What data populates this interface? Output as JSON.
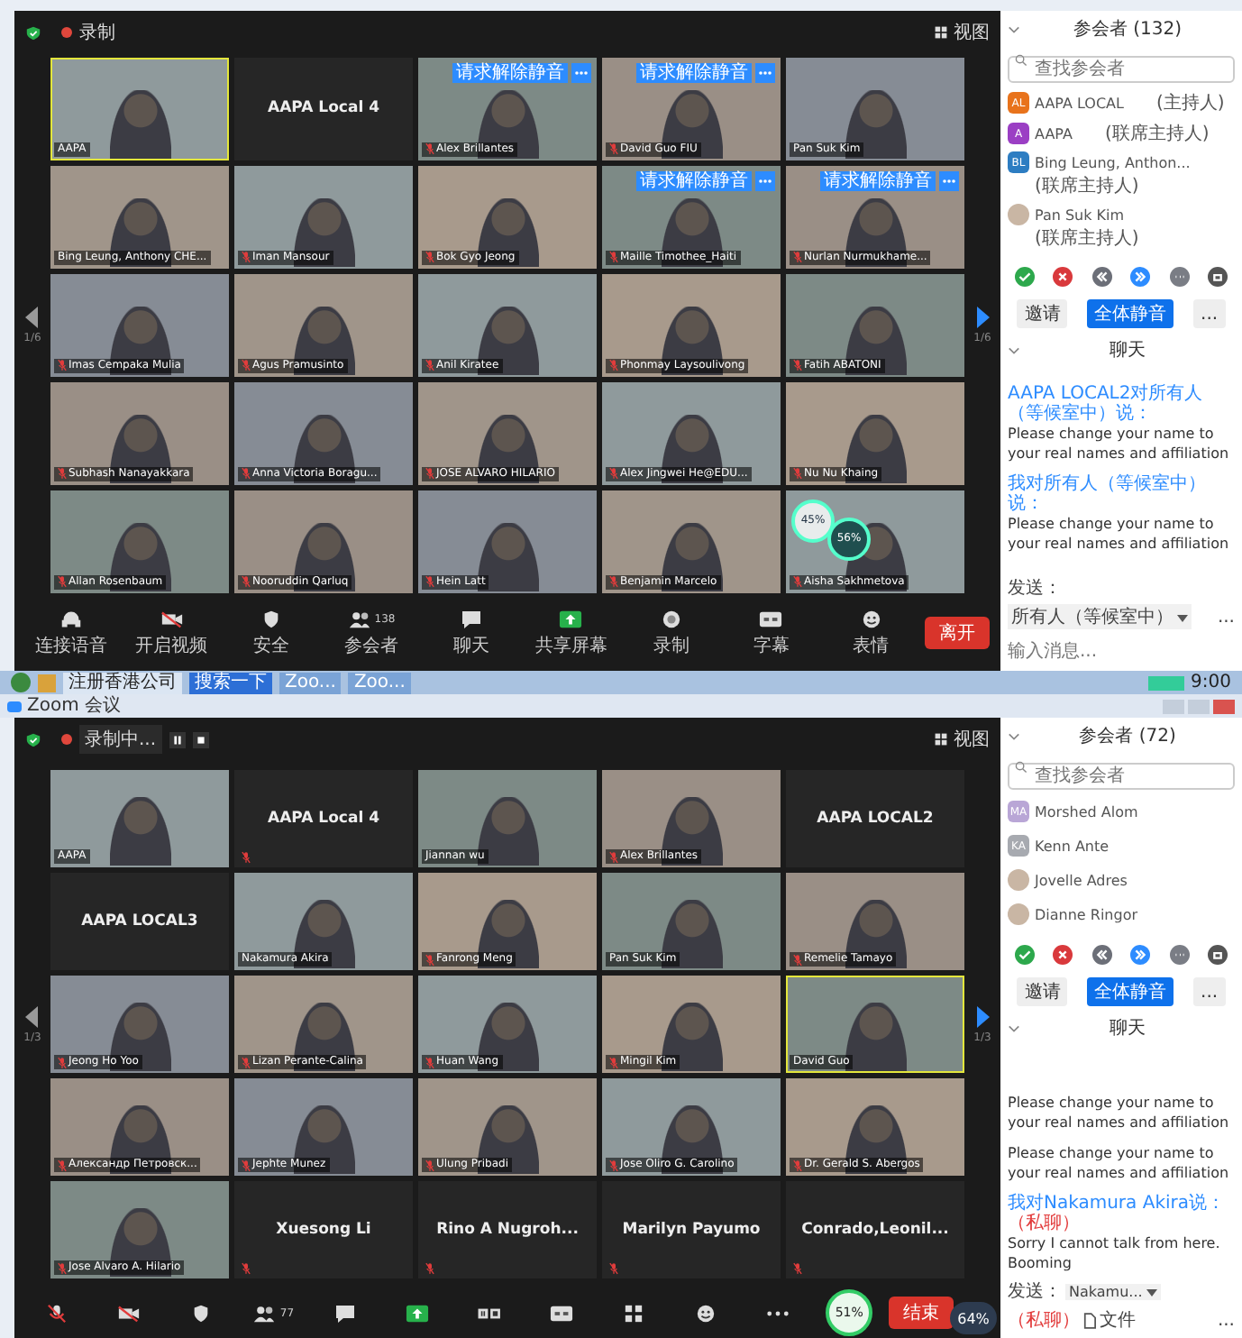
{
  "windows": [
    {
      "recording": {
        "label": "录制",
        "controls": false
      },
      "view_label": "视图",
      "page_left": "1/6",
      "page_right": "1/6",
      "tiles": [
        {
          "name": "AAPA",
          "kind": "video",
          "muted": false,
          "selected": true
        },
        {
          "name": "AAPA Local 4",
          "kind": "name",
          "muted": false,
          "selected": false
        },
        {
          "name": "Alex Brillantes",
          "kind": "video",
          "muted": true,
          "selected": false,
          "request": "请求解除静音"
        },
        {
          "name": "David Guo FIU",
          "kind": "video",
          "muted": true,
          "selected": false,
          "request": "请求解除静音"
        },
        {
          "name": "Pan Suk Kim",
          "kind": "video",
          "muted": false,
          "selected": false
        },
        {
          "name": "Bing Leung, Anthony CHE...",
          "kind": "video",
          "muted": false,
          "selected": false
        },
        {
          "name": "Iman Mansour",
          "kind": "video",
          "muted": true,
          "selected": false
        },
        {
          "name": "Bok Gyo Jeong",
          "kind": "video",
          "muted": true,
          "selected": false
        },
        {
          "name": "Maille Timothee_Haiti",
          "kind": "video",
          "muted": true,
          "selected": false,
          "request": "请求解除静音"
        },
        {
          "name": "Nurlan Nurmukhame...",
          "kind": "video",
          "muted": true,
          "selected": false,
          "request": "请求解除静音"
        },
        {
          "name": "Imas Cempaka Mulia",
          "kind": "video",
          "muted": true,
          "selected": false
        },
        {
          "name": "Agus Pramusinto",
          "kind": "video",
          "muted": true,
          "selected": false
        },
        {
          "name": "Anil Kiratee",
          "kind": "video",
          "muted": true,
          "selected": false
        },
        {
          "name": "Phonmay Laysoulivong",
          "kind": "video",
          "muted": true,
          "selected": false
        },
        {
          "name": "Fatih ABATONI",
          "kind": "video",
          "muted": true,
          "selected": false
        },
        {
          "name": "Subhash Nanayakkara",
          "kind": "video",
          "muted": true,
          "selected": false
        },
        {
          "name": "Anna Victoria Boragu...",
          "kind": "video",
          "muted": true,
          "selected": false
        },
        {
          "name": "JOSE ALVARO HILARIO",
          "kind": "video",
          "muted": true,
          "selected": false
        },
        {
          "name": "Alex Jingwei He@EDU...",
          "kind": "video",
          "muted": true,
          "selected": false
        },
        {
          "name": "Nu Nu Khaing",
          "kind": "video",
          "muted": true,
          "selected": false
        },
        {
          "name": "Allan Rosenbaum",
          "kind": "video",
          "muted": true,
          "selected": false
        },
        {
          "name": "Nooruddin Qarluq",
          "kind": "video",
          "muted": true,
          "selected": false
        },
        {
          "name": "Hein Latt",
          "kind": "video",
          "muted": true,
          "selected": false
        },
        {
          "name": "Benjamin Marcelo",
          "kind": "video",
          "muted": true,
          "selected": false
        },
        {
          "name": "Aisha Sakhmetova",
          "kind": "video",
          "muted": true,
          "selected": false,
          "meters": [
            "45%",
            "56%"
          ]
        }
      ],
      "toolbar": [
        {
          "kind": "audio",
          "label": "连接语音",
          "off": false
        },
        {
          "kind": "video",
          "label": "开启视频",
          "off": true
        },
        {
          "kind": "security",
          "label": "安全"
        },
        {
          "kind": "participants",
          "label": "参会者",
          "count": "138"
        },
        {
          "kind": "chat",
          "label": "聊天"
        },
        {
          "kind": "share",
          "label": "共享屏幕"
        },
        {
          "kind": "record",
          "label": "录制"
        },
        {
          "kind": "captions",
          "label": "字幕"
        },
        {
          "kind": "reactions",
          "label": "表情"
        }
      ],
      "end_button": "离开",
      "participants": {
        "title": "参会者 (132)",
        "search_placeholder": "查找参会者",
        "items": [
          {
            "name": "AAPA LOCAL",
            "role": "(主持人)",
            "initials": "AL",
            "color": "#e8731c"
          },
          {
            "name": "AAPA",
            "role": "(联席主持人)",
            "initials": "A",
            "color": "#9b3fc4"
          },
          {
            "name": "Bing Leung, Anthon...",
            "role": "(联席主持人)",
            "initials": "BL",
            "color": "#2d7dc2"
          },
          {
            "name": "Pan Suk Kim",
            "role": "(联席主持人)"
          }
        ]
      },
      "reactions": [
        {
          "kind": "yes"
        },
        {
          "kind": "no"
        },
        {
          "kind": "slower"
        },
        {
          "kind": "faster"
        },
        {
          "kind": "more"
        },
        {
          "kind": "coffee"
        }
      ],
      "panel_buttons": [
        {
          "label": "邀请",
          "primary": false
        },
        {
          "label": "全体静音",
          "primary": true
        },
        {
          "label": "...",
          "primary": false
        }
      ],
      "chat": {
        "title": "聊天",
        "messages": [
          {
            "header": "AAPA LOCAL2对所有人（等候室中）说：",
            "text": "Please change your name to your real names and affiliation"
          },
          {
            "header": "我对所有人（等候室中）说：",
            "text": "Please change your name to your real names and affiliation"
          }
        ],
        "footer": {
          "label": "发送：",
          "recipient": "所有人（等候室中）",
          "more": "...",
          "placeholder": "输入消息..."
        }
      }
    },
    {
      "title": "Zoom 会议",
      "recording": {
        "label": "录制中...",
        "controls": true
      },
      "view_label": "视图",
      "page_left": "1/3",
      "page_right": "1/3",
      "tiles": [
        {
          "name": "AAPA",
          "kind": "video",
          "muted": false,
          "selected": false
        },
        {
          "name": "AAPA Local 4",
          "kind": "name",
          "muted": true,
          "selected": false
        },
        {
          "name": "Jiannan wu",
          "kind": "video",
          "muted": false,
          "selected": false
        },
        {
          "name": "Alex Brillantes",
          "kind": "video",
          "muted": true,
          "selected": false
        },
        {
          "name": "AAPA LOCAL2",
          "kind": "name",
          "muted": false,
          "selected": false
        },
        {
          "name": "AAPA LOCAL3",
          "kind": "name",
          "muted": false,
          "selected": false
        },
        {
          "name": "Nakamura Akira",
          "kind": "video",
          "muted": false,
          "selected": false
        },
        {
          "name": "Fanrong Meng",
          "kind": "video",
          "muted": true,
          "selected": false
        },
        {
          "name": "Pan Suk Kim",
          "kind": "video",
          "muted": false,
          "selected": false
        },
        {
          "name": "Remelie Tamayo",
          "kind": "video",
          "muted": true,
          "selected": false
        },
        {
          "name": "Jeong Ho Yoo",
          "kind": "video",
          "muted": true,
          "selected": false
        },
        {
          "name": "Lizan Perante-Calina",
          "kind": "video",
          "muted": true,
          "selected": false
        },
        {
          "name": "Huan Wang",
          "kind": "video",
          "muted": true,
          "selected": false
        },
        {
          "name": "Mingil Kim",
          "kind": "video",
          "muted": true,
          "selected": false
        },
        {
          "name": "David Guo",
          "kind": "video",
          "muted": false,
          "selected": true
        },
        {
          "name": "Александр Петровск...",
          "kind": "video",
          "muted": true,
          "selected": false
        },
        {
          "name": "Jephte Munez",
          "kind": "video",
          "muted": true,
          "selected": false
        },
        {
          "name": "Ulung Pribadi",
          "kind": "video",
          "muted": true,
          "selected": false
        },
        {
          "name": "Jose Oliro G. Carolino",
          "kind": "video",
          "muted": true,
          "selected": false
        },
        {
          "name": "Dr. Gerald S. Abergos",
          "kind": "video",
          "muted": true,
          "selected": false
        },
        {
          "name": "Jose Alvaro A. Hilario",
          "kind": "video",
          "muted": true,
          "selected": false
        },
        {
          "name": "Xuesong Li",
          "kind": "name",
          "muted": true,
          "selected": false
        },
        {
          "name": "Rino A Nugroh...",
          "kind": "name",
          "muted": true,
          "selected": false
        },
        {
          "name": "Marilyn Payumo",
          "kind": "name",
          "muted": true,
          "selected": false
        },
        {
          "name": "Conrado,Leonil...",
          "kind": "name",
          "muted": true,
          "selected": false
        }
      ],
      "toolbar": [
        {
          "kind": "audio",
          "off": true
        },
        {
          "kind": "video",
          "off": true
        },
        {
          "kind": "security"
        },
        {
          "kind": "participants",
          "count": "77"
        },
        {
          "kind": "chat"
        },
        {
          "kind": "share"
        },
        {
          "kind": "pause-stop"
        },
        {
          "kind": "captions"
        },
        {
          "kind": "apps"
        },
        {
          "kind": "reactions"
        },
        {
          "kind": "more"
        },
        {
          "kind": "meter",
          "label": "51%"
        }
      ],
      "end_button": "结束",
      "participants": {
        "title": "参会者 (72)",
        "search_placeholder": "查找参会者",
        "items": [
          {
            "name": "Morshed Alom",
            "initials": "MA",
            "color": "#b9a6d6"
          },
          {
            "name": "Kenn Ante",
            "initials": "KA",
            "color": "#a7aab0"
          },
          {
            "name": "Jovelle Adres"
          },
          {
            "name": "Dianne Ringor"
          }
        ]
      },
      "reactions": [
        {
          "kind": "yes"
        },
        {
          "kind": "no"
        },
        {
          "kind": "slower"
        },
        {
          "kind": "faster"
        },
        {
          "kind": "more"
        },
        {
          "kind": "coffee"
        }
      ],
      "panel_buttons": [
        {
          "label": "邀请",
          "primary": false
        },
        {
          "label": "全体静音",
          "primary": true
        },
        {
          "label": "...",
          "primary": false
        }
      ],
      "chat": {
        "title": "聊天",
        "messages": [
          {
            "text": "Please change your name to your real names and affiliation"
          },
          {
            "text": "Please change your name to your real names and affiliation"
          },
          {
            "header": "我对Nakamura Akira说：",
            "tag": "（私聊）",
            "text": "Sorry I cannot talk from here. Booming"
          }
        ],
        "footer": {
          "label": "发送：",
          "recipient": "Nakamu...",
          "tag": "（私聊）",
          "file": "文件",
          "more": "..."
        }
      },
      "overlay_meter": "64%"
    }
  ],
  "taskbar": {
    "items": [
      {
        "kind": "ie",
        "label": "注册香港公司"
      },
      {
        "kind": "search",
        "label": "搜索一下"
      },
      {
        "kind": "zoom",
        "label": "Zoo..."
      },
      {
        "kind": "zoom",
        "label": "Zoo..."
      }
    ],
    "clock": "9:00"
  }
}
